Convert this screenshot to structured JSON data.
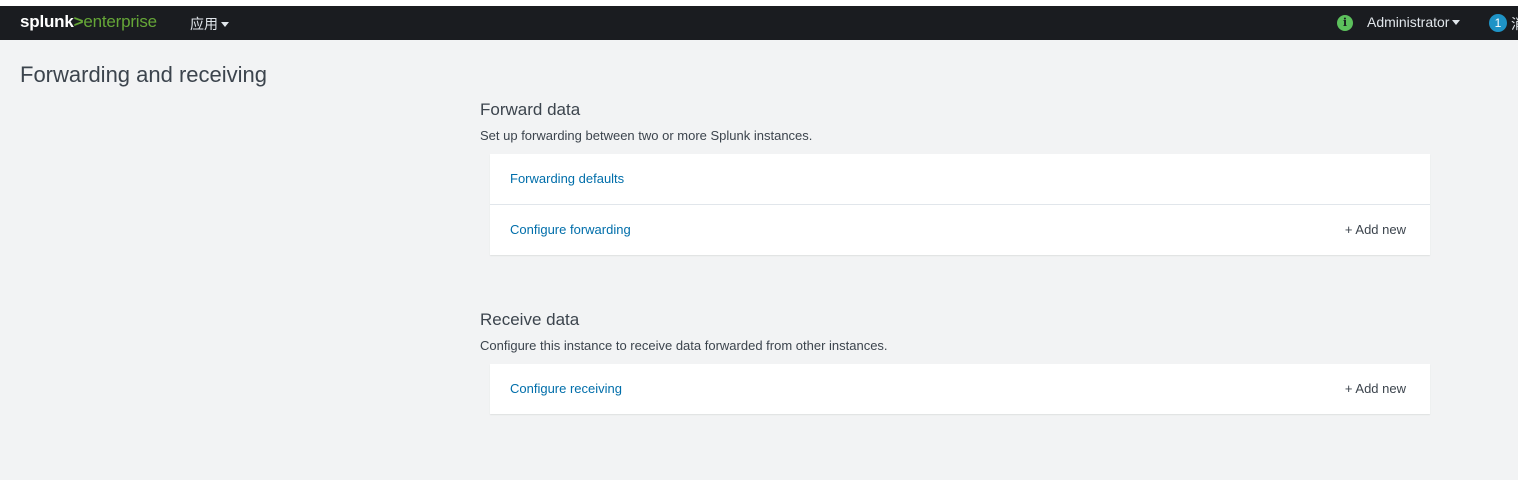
{
  "navbar": {
    "logo_part1": "splunk",
    "logo_part2": ">",
    "logo_part3": "enterprise",
    "apps_label": "应用",
    "info_icon_glyph": "i",
    "user_label": "Administrator",
    "messages_count": "1",
    "messages_label_partial": "消"
  },
  "page": {
    "title": "Forwarding and receiving"
  },
  "forward": {
    "heading": "Forward data",
    "description": "Set up forwarding between two or more Splunk instances.",
    "rows": [
      {
        "label": "Forwarding defaults",
        "action": ""
      },
      {
        "label": "Configure forwarding",
        "action": "+ Add new"
      }
    ]
  },
  "receive": {
    "heading": "Receive data",
    "description": "Configure this instance to receive data forwarded from other instances.",
    "rows": [
      {
        "label": "Configure receiving",
        "action": "+ Add new"
      }
    ]
  },
  "colors": {
    "navbar_bg": "#1a1c20",
    "page_bg": "#f2f3f4",
    "link": "#006eaa",
    "brand_green": "#65a637",
    "badge_blue": "#1e93c6"
  },
  "icons": {
    "info": "info-circle-icon",
    "apps_caret": "caret-down-icon",
    "user_caret": "caret-down-icon"
  }
}
